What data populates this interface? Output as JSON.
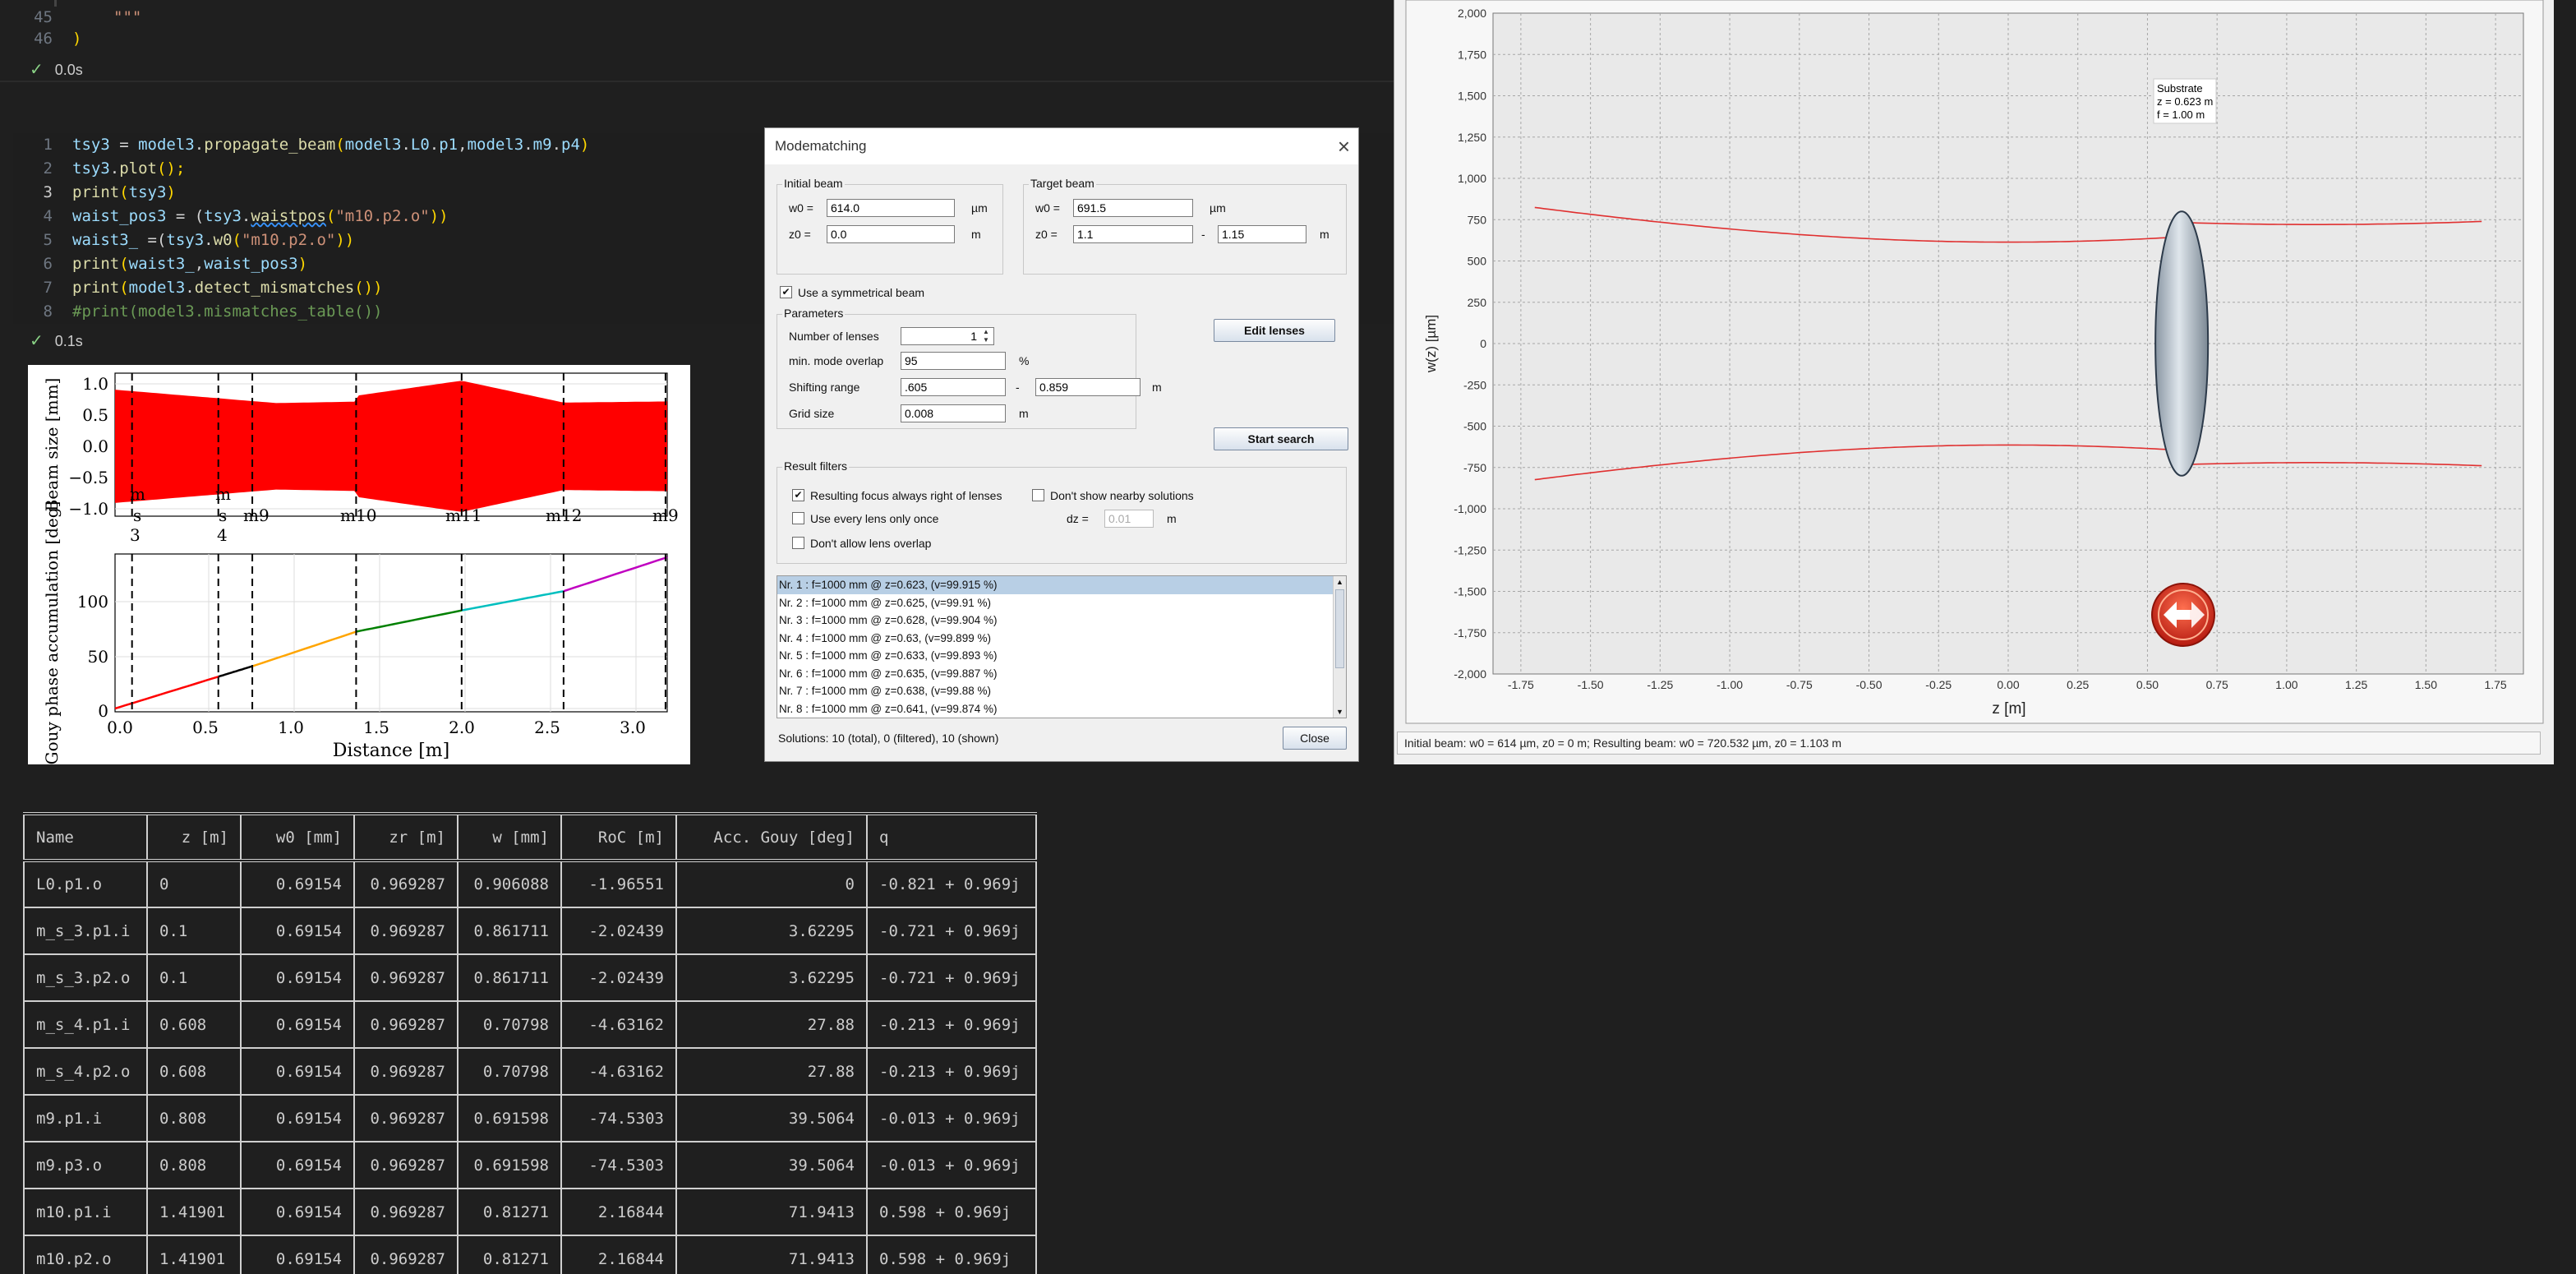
{
  "prev_cell": {
    "lines": [
      {
        "num": "45",
        "text": "\"\"\""
      },
      {
        "num": "46",
        "text": ")"
      }
    ],
    "status": "0.0s"
  },
  "code_cell": {
    "status": "0.1s",
    "lines": [
      {
        "num": "1"
      },
      {
        "num": "2"
      },
      {
        "num": "3"
      },
      {
        "num": "4"
      },
      {
        "num": "5"
      },
      {
        "num": "6"
      },
      {
        "num": "7"
      },
      {
        "num": "8"
      }
    ]
  },
  "code": {
    "l1": [
      "tsy3",
      " = ",
      "model3",
      ".",
      "propagate_beam",
      "(",
      "model3",
      ".",
      "L0",
      ".",
      "p1",
      ",",
      "model3",
      ".",
      "m9",
      ".",
      "p4",
      ")"
    ],
    "l2": [
      "tsy3",
      ".",
      "plot",
      "();"
    ],
    "l3": [
      "print",
      "(",
      "tsy3",
      ")"
    ],
    "l4": [
      "waist_pos3",
      " = (",
      "tsy3",
      ".",
      "waistpos",
      "(",
      "\"m10.p2.o\"",
      "))"
    ],
    "l5": [
      "waist3_",
      " =(",
      "tsy3",
      ".",
      "w0",
      "(",
      "\"m10.p2.o\"",
      "))"
    ],
    "l6": [
      "print",
      "(",
      "waist3_",
      ",",
      "waist_pos3",
      ")"
    ],
    "l7": [
      "print",
      "(",
      "model3",
      ".",
      "detect_mismatches",
      "())"
    ],
    "l8": "#print(model3.mismatches_table())"
  },
  "plot_left": {
    "top": {
      "ylabel": "Beam size [mm]",
      "yticks": [
        "1.0",
        "0.5",
        "0.0",
        "−0.5",
        "−1.0"
      ],
      "comp_labels": [
        {
          "a": "s",
          "b": "3",
          "c": "m"
        },
        {
          "a": "s",
          "b": "4",
          "c": "m"
        },
        {
          "a": "m9"
        },
        {
          "a": "m10"
        },
        {
          "a": "m11"
        },
        {
          "a": "m12"
        },
        {
          "a": "m9"
        }
      ]
    },
    "bottom": {
      "ylabel": "Gouy phase accumulation [deg]",
      "xlabel": "Distance [m]",
      "yticks": [
        "100",
        "50",
        "0"
      ],
      "xticks": [
        "0.0",
        "0.5",
        "1.0",
        "1.5",
        "2.0",
        "2.5",
        "3.0"
      ]
    },
    "colors": {
      "beam": "#ff0000",
      "seg1": "#ff0000",
      "seg2": "#000000",
      "seg3": "#ffa500",
      "seg4": "#008000",
      "seg5": "#00bfbf",
      "seg6": "#c000c0"
    }
  },
  "table": {
    "headers": [
      "Name",
      "z [m]",
      "w0 [mm]",
      "zr [m]",
      "w [mm]",
      "RoC [m]",
      "Acc. Gouy [deg]",
      "q"
    ],
    "rows": [
      [
        "L0.p1.o",
        "0",
        "0.69154",
        "0.969287",
        "0.906088",
        "-1.96551",
        "0",
        "-0.821 + 0.969j"
      ],
      [
        "m_s_3.p1.i",
        "0.1",
        "0.69154",
        "0.969287",
        "0.861711",
        "-2.02439",
        "3.62295",
        "-0.721 + 0.969j"
      ],
      [
        "m_s_3.p2.o",
        "0.1",
        "0.69154",
        "0.969287",
        "0.861711",
        "-2.02439",
        "3.62295",
        "-0.721 + 0.969j"
      ],
      [
        "m_s_4.p1.i",
        "0.608",
        "0.69154",
        "0.969287",
        "0.70798",
        "-4.63162",
        "27.88",
        "-0.213 + 0.969j"
      ],
      [
        "m_s_4.p2.o",
        "0.608",
        "0.69154",
        "0.969287",
        "0.70798",
        "-4.63162",
        "27.88",
        "-0.213 + 0.969j"
      ],
      [
        "m9.p1.i",
        "0.808",
        "0.69154",
        "0.969287",
        "0.691598",
        "-74.5303",
        "39.5064",
        "-0.013 + 0.969j"
      ],
      [
        "m9.p3.o",
        "0.808",
        "0.69154",
        "0.969287",
        "0.691598",
        "-74.5303",
        "39.5064",
        "-0.013 + 0.969j"
      ],
      [
        "m10.p1.i",
        "1.41901",
        "0.69154",
        "0.969287",
        "0.81271",
        "2.16844",
        "71.9413",
        "0.598 + 0.969j"
      ],
      [
        "m10.p2.o",
        "1.41901",
        "0.69154",
        "0.969287",
        "0.81271",
        "2.16844",
        "71.9413",
        "0.598 + 0.969j"
      ]
    ]
  },
  "dialog": {
    "title": "Modematching",
    "initial": {
      "label": "Initial beam",
      "w0_label": "w0 =",
      "w0": "614.0",
      "w0_unit": "µm",
      "z0_label": "z0 =",
      "z0": "0.0",
      "z0_unit": "m"
    },
    "target": {
      "label": "Target beam",
      "w0_label": "w0 =",
      "w0": "691.5",
      "w0_unit": "µm",
      "z0_label": "z0 =",
      "z0": "1.1",
      "z0b": "1.15",
      "dash": "-",
      "z0_unit": "m"
    },
    "sym_label": "Use a symmetrical beam",
    "params": {
      "label": "Parameters",
      "nlens_label": "Number of lenses",
      "nlens": "1",
      "overlap_label": "min. mode overlap",
      "overlap": "95",
      "overlap_unit": "%",
      "shift_label": "Shifting range",
      "shift_a": ".605",
      "shift_b": "0.859",
      "dash": "-",
      "shift_unit": "m",
      "grid_label": "Grid size",
      "grid": "0.008",
      "grid_unit": "m"
    },
    "edit_btn": "Edit lenses",
    "search_btn": "Start search",
    "filters": {
      "label": "Result filters",
      "f1": "Resulting focus always right of lenses",
      "f2": "Don't show nearby solutions",
      "f3": "Use every lens only once",
      "dz_label": "dz =",
      "dz": "0.01",
      "dz_unit": "m",
      "f4": "Don't allow lens overlap"
    },
    "results": [
      "Nr. 1 : f=1000 mm @ z=0.623,  (v=99.915 %)",
      "Nr. 2 : f=1000 mm @ z=0.625,  (v=99.91 %)",
      "Nr. 3 : f=1000 mm @ z=0.628,  (v=99.904 %)",
      "Nr. 4 : f=1000 mm @ z=0.63,  (v=99.899 %)",
      "Nr. 5 : f=1000 mm @ z=0.633,  (v=99.893 %)",
      "Nr. 6 : f=1000 mm @ z=0.635,  (v=99.887 %)",
      "Nr. 7 : f=1000 mm @ z=0.638,  (v=99.88 %)",
      "Nr. 8 : f=1000 mm @ z=0.641,  (v=99.874 %)"
    ],
    "solutions": "Solutions: 10 (total), 0 (filtered), 10 (shown)",
    "close_btn": "Close"
  },
  "plot_right": {
    "ylabel": "w(z) [µm]",
    "xlabel": "z [m]",
    "yticks": [
      "2,000",
      "1,750",
      "1,500",
      "1,250",
      "1,000",
      "750",
      "500",
      "250",
      "0",
      "-250",
      "-500",
      "-750",
      "-1,000",
      "-1,250",
      "-1,500",
      "-1,750",
      "-2,000"
    ],
    "xticks": [
      "-1.75",
      "-1.50",
      "-1.25",
      "-1.00",
      "-0.75",
      "-0.50",
      "-0.25",
      "0.00",
      "0.25",
      "0.50",
      "0.75",
      "1.00",
      "1.25",
      "1.50",
      "1.75"
    ],
    "annotation": [
      "Substrate",
      "z = 0.623 m",
      "f = 1.00 m"
    ],
    "status": "Initial beam: w0 = 614 µm, z0 = 0 m; Resulting beam: w0 = 720.532 µm, z0 = 1.103 m",
    "colors": {
      "beam": "#e03030",
      "lens": "#b9c4cf",
      "button": "#d93020"
    }
  }
}
